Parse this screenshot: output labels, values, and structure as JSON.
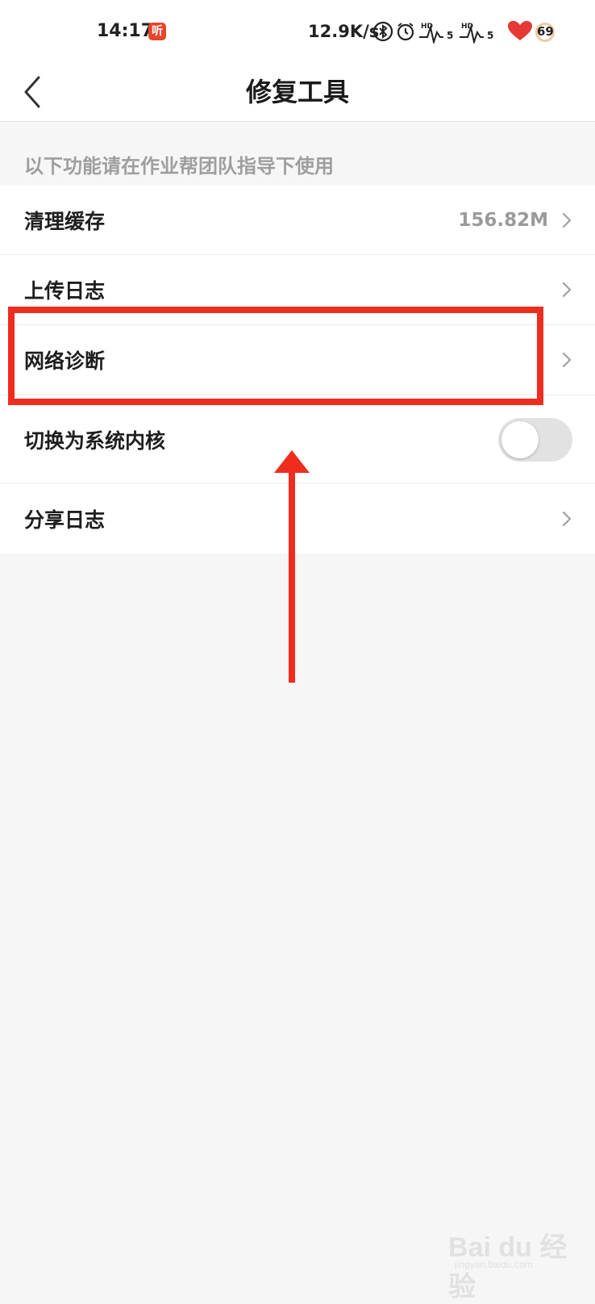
{
  "status_bar": {
    "time": "14:17",
    "app_badge": "听",
    "net_speed": "12.9K/s",
    "battery": "69",
    "signal_label_1": "HD",
    "signal_label_2": "5",
    "signal_label_3": "HD",
    "signal_label_4": "5"
  },
  "nav": {
    "title": "修复工具"
  },
  "hint": "以下功能请在作业帮团队指导下使用",
  "items": [
    {
      "label": "清理缓存",
      "value": "156.82M"
    },
    {
      "label": "上传日志"
    },
    {
      "label": "网络诊断"
    },
    {
      "label": "切换为系统内核",
      "toggle_on": false
    },
    {
      "label": "分享日志"
    }
  ],
  "watermark": {
    "text": "Bai du 经验",
    "sub": "jingyan.baidu.com"
  },
  "colors": {
    "annotation": "#f02c1e",
    "background": "#f6f6f6",
    "hint_text": "#9e9e9e"
  }
}
